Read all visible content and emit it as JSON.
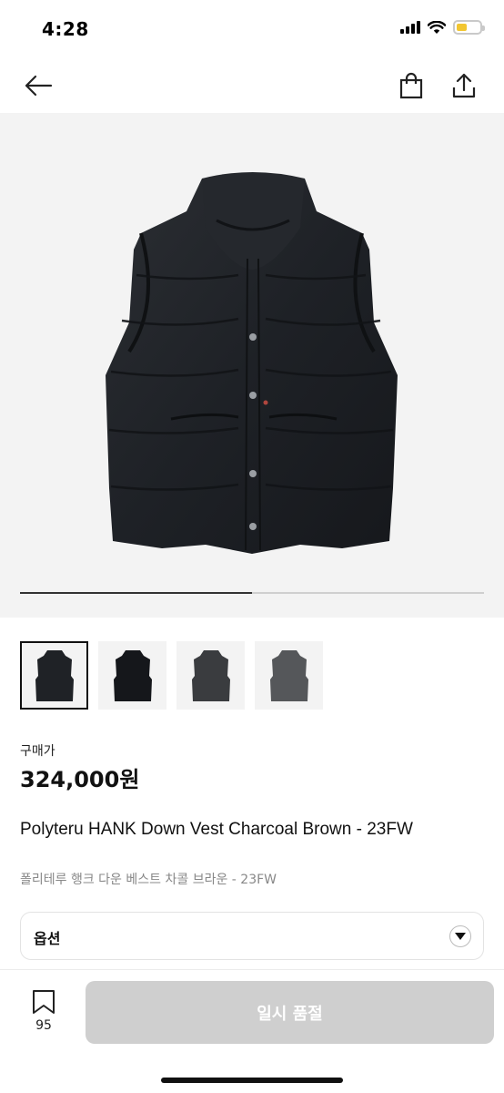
{
  "status_bar": {
    "time": "4:28",
    "icons": [
      "signal-icon",
      "wifi-icon",
      "battery-icon"
    ],
    "battery_color": "#f2c631"
  },
  "nav": {
    "icons": [
      "arrow-left-icon",
      "shopping-bag-icon",
      "share-icon"
    ]
  },
  "gallery": {
    "image_count": 4,
    "current_index": 1,
    "progress_fraction": 0.5,
    "thumb_colors": [
      "#1f2226",
      "#15171b",
      "#3a3c3f",
      "#55575a"
    ]
  },
  "product": {
    "price_label": "구매가",
    "price": "324,000원",
    "name_en": "Polyteru HANK Down Vest Charcoal Brown - 23FW",
    "name_ko": "폴리테루 행크 다운 베스트 차콜 브라운 - 23FW"
  },
  "option": {
    "label": "옵션"
  },
  "bottom_bar": {
    "bookmark_count": "95",
    "buy_button_label": "일시 품절",
    "buy_button_color": "#cfcfcf"
  }
}
